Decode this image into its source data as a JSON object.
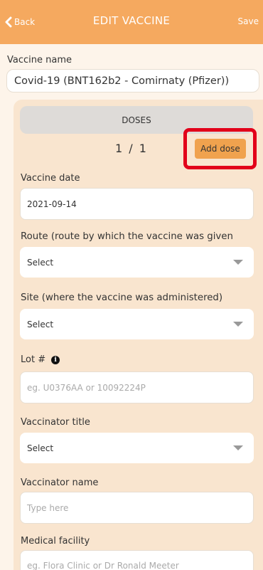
{
  "header": {
    "back_label": "Back",
    "title": "EDIT VACCINE",
    "save_label": "Save"
  },
  "vaccine_name": {
    "label": "Vaccine name",
    "value": "Covid-19 (BNT162b2 - Comirnaty (Pfizer))"
  },
  "doses": {
    "header": "DOSES",
    "counter": "1 / 1",
    "add_dose_label": "Add dose"
  },
  "vaccine_date": {
    "label": "Vaccine date",
    "value": "2021-09-14"
  },
  "route": {
    "label": "Route (route by which the vaccine was given",
    "value": "Select"
  },
  "site": {
    "label": "Site (where the vaccine was administered)",
    "value": "Select"
  },
  "lot": {
    "label": "Lot #",
    "info_glyph": "i",
    "placeholder": "eg. U0376AA or 10092224P"
  },
  "vaccinator_title": {
    "label": "Vaccinator title",
    "value": "Select"
  },
  "vaccinator_name": {
    "label": "Vaccinator name",
    "placeholder": "Type here"
  },
  "medical_facility": {
    "label": "Medical facility",
    "placeholder": "eg. Flora Clinic or Dr Ronald Meeter"
  },
  "colors": {
    "header_bg": "#f5a95f",
    "page_bg": "#fdf4ea",
    "panel_bg": "#f9e5cf",
    "add_dose_bg": "#f0a24e",
    "highlight": "#e2001a"
  }
}
